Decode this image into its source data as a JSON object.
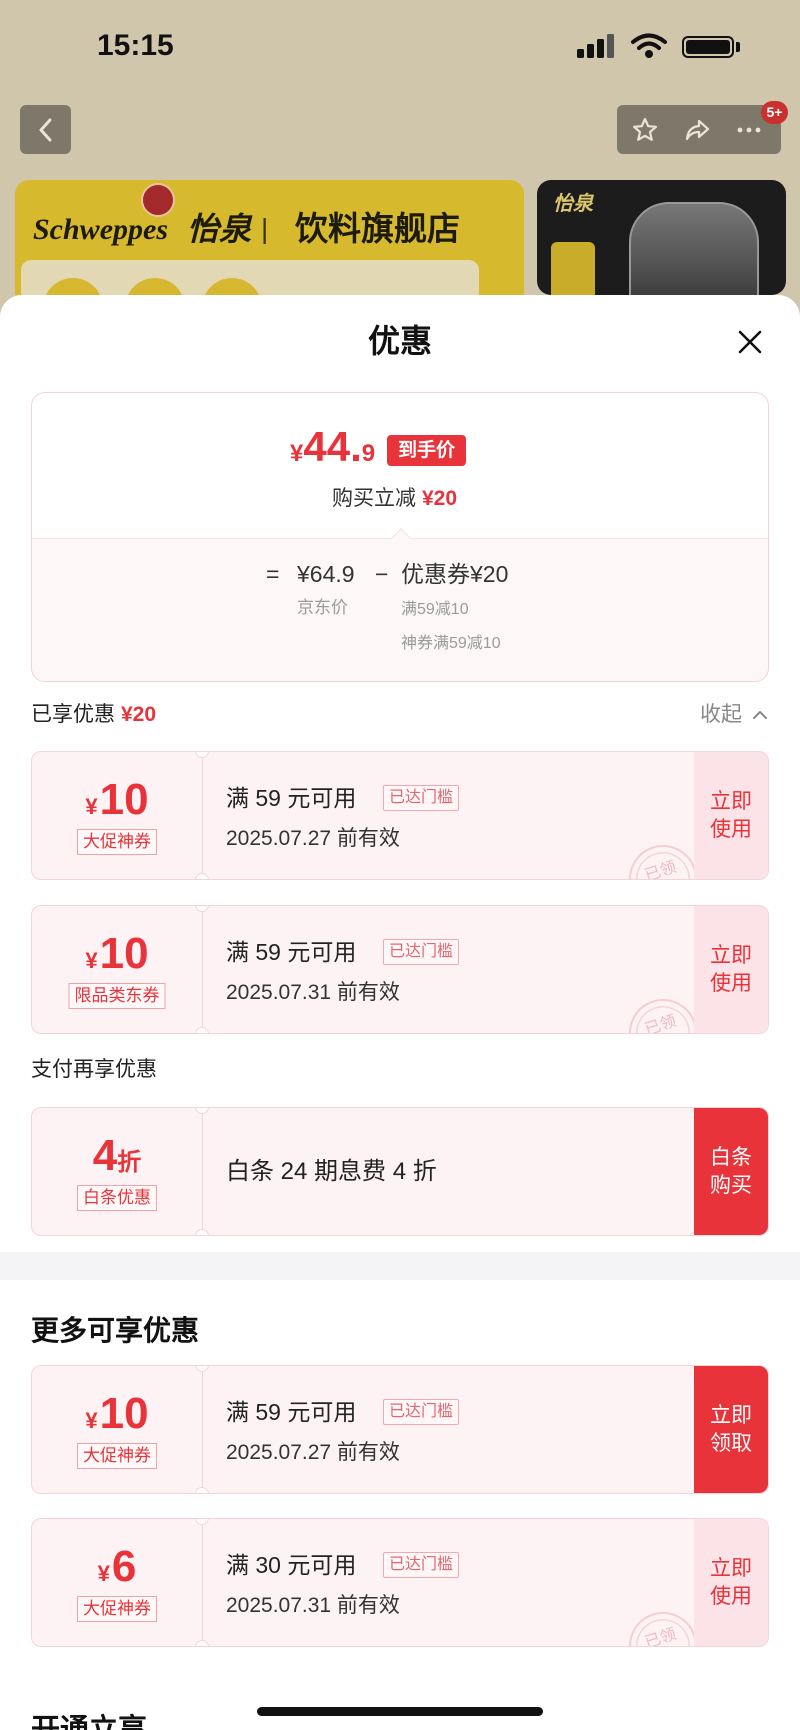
{
  "status_bar": {
    "time": "15:15"
  },
  "background_page": {
    "more_badge": "5+",
    "store_banner": {
      "brand_latin": "Schweppes",
      "brand_cn": "怡泉",
      "separator": "|",
      "store_name": "饮料旗舰店"
    },
    "product_image": {
      "logo_text": "怡泉"
    }
  },
  "sheet": {
    "title": "优惠",
    "price_card": {
      "final_price": {
        "currency": "¥",
        "integer": "44.",
        "decimal": "9"
      },
      "final_price_badge": "到手价",
      "instant_discount_label": "购买立减",
      "instant_discount_amount": "¥20",
      "breakdown": {
        "equals": "=",
        "jd_price": "¥64.9",
        "minus": "−",
        "coupon_total": "优惠券¥20",
        "jd_price_label": "京东价",
        "coupon_details": [
          "满59减10",
          "神券满59减10"
        ]
      }
    },
    "enjoyed": {
      "label": "已享优惠",
      "amount": "¥20",
      "collapse_label": "收起"
    },
    "enjoyed_coupons": [
      {
        "currency": "¥",
        "amount": "10",
        "tag": "大促神券",
        "condition": "满 59 元可用",
        "threshold_badge": "已达门槛",
        "validity": "2025.07.27 前有效",
        "action": [
          "立即",
          "使用"
        ],
        "stamp": "已领"
      },
      {
        "currency": "¥",
        "amount": "10",
        "tag": "限品类东券",
        "condition": "满 59 元可用",
        "threshold_badge": "已达门槛",
        "validity": "2025.07.31 前有效",
        "action": [
          "立即",
          "使用"
        ],
        "stamp": "已领"
      }
    ],
    "payment_section": {
      "title": "支付再享优惠",
      "offers": [
        {
          "amount": "4",
          "unit": "折",
          "tag": "白条优惠",
          "description": "白条 24 期息费 4 折",
          "action": [
            "白条",
            "购买"
          ]
        }
      ]
    },
    "more_section": {
      "title": "更多可享优惠",
      "coupons": [
        {
          "currency": "¥",
          "amount": "10",
          "tag": "大促神券",
          "condition": "满 59 元可用",
          "threshold_badge": "已达门槛",
          "validity": "2025.07.27 前有效",
          "action": [
            "立即",
            "领取"
          ]
        },
        {
          "currency": "¥",
          "amount": "6",
          "tag": "大促神券",
          "condition": "满 30 元可用",
          "threshold_badge": "已达门槛",
          "validity": "2025.07.31 前有效",
          "action": [
            "立即",
            "使用"
          ],
          "stamp": "已领"
        }
      ]
    },
    "next_section_title": "开通立享"
  },
  "icons": [
    "back-chevron-icon",
    "star-icon",
    "share-icon",
    "more-icon",
    "close-icon",
    "chevron-up-icon",
    "signal-icon",
    "wifi-icon",
    "battery-icon"
  ],
  "colors": {
    "accent_red": "#e8333a",
    "coupon_bg": "#fdf3f5",
    "coupon_border": "#f5d3d7",
    "action_pink_bg": "#fbe3e7",
    "banner_yellow": "#d6b92c",
    "overlay_bg": "#cfc6ac"
  }
}
